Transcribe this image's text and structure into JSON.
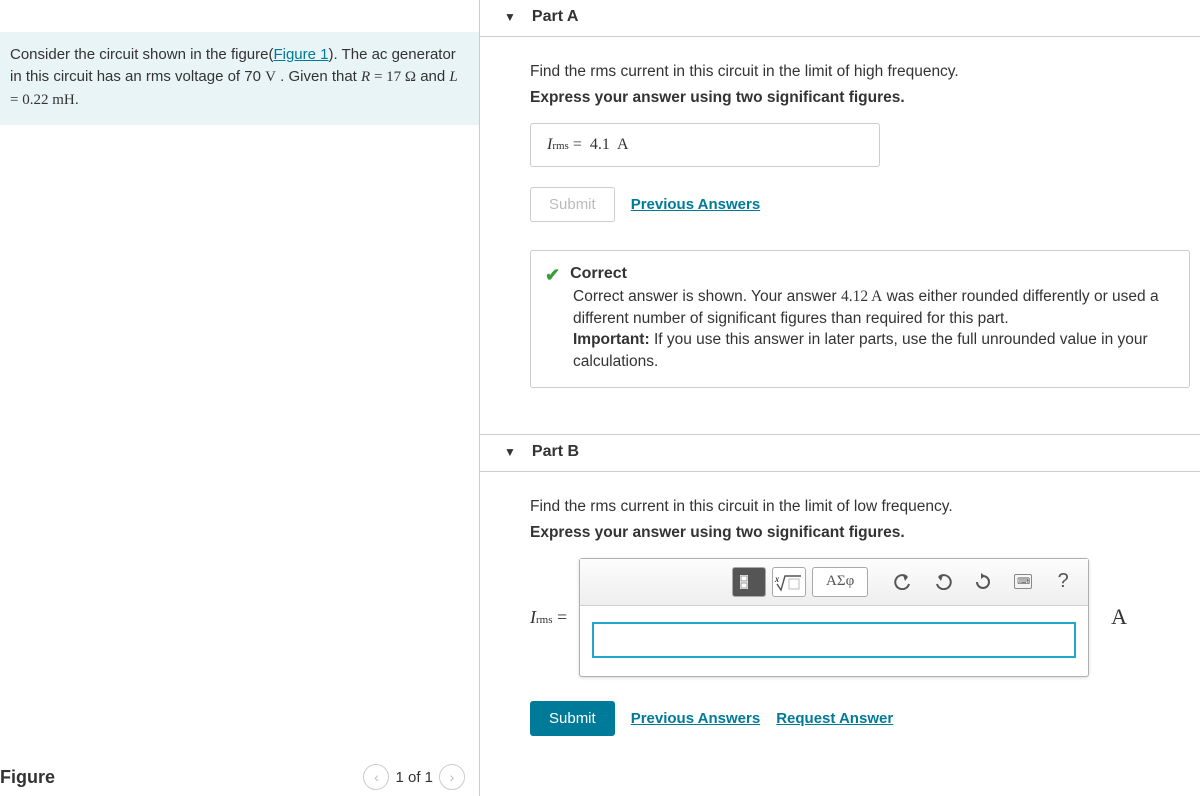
{
  "problem": {
    "text_before_link": "Consider the circuit shown in the figure(",
    "link_text": "Figure 1",
    "text_after_link": "). The ac generator in this circuit has an rms voltage of 70 ",
    "voltage_unit": "V",
    "period": " . Given that ",
    "r_expr": "R = 17 Ω",
    "and": " and ",
    "l_expr": "L = 0.22 mH",
    "tail": "."
  },
  "figure": {
    "title": "Figure",
    "pager": "1 of 1"
  },
  "partA": {
    "title": "Part A",
    "prompt": "Find the rms current in this circuit in the limit of high frequency.",
    "instruction": "Express your answer using two significant figures.",
    "answer_label_var": "I",
    "answer_label_sub": "rms",
    "answer_label_eq": " = ",
    "answer_value": "4.1",
    "answer_unit": " A",
    "submit": "Submit",
    "prev": "Previous Answers",
    "fb_title": "Correct",
    "fb_line1a": "Correct answer is shown. Your answer ",
    "fb_value": "4.12 A",
    "fb_line1b": " was either rounded differently or used a different number of significant figures than required for this part.",
    "fb_important_label": "Important:",
    "fb_important_text": " If you use this answer in later parts, use the full unrounded value in your calculations."
  },
  "partB": {
    "title": "Part B",
    "prompt": "Find the rms current in this circuit in the limit of low frequency.",
    "instruction": "Express your answer using two significant figures.",
    "greek_btn": "ΑΣφ",
    "help_btn": "?",
    "label_var": "I",
    "label_sub": "rms",
    "label_eq": " = ",
    "unit": "A",
    "submit": "Submit",
    "prev": "Previous Answers",
    "request": "Request Answer"
  }
}
